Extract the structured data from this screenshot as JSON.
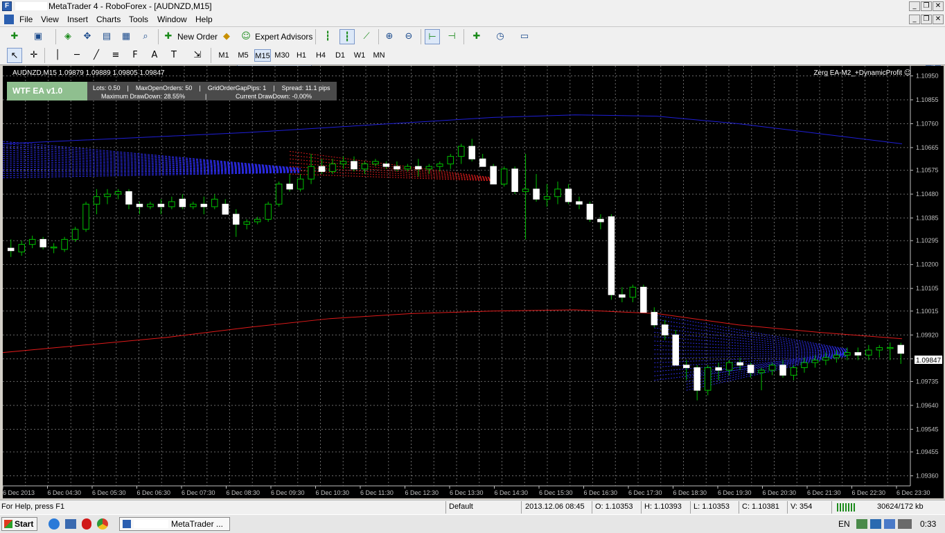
{
  "window": {
    "title": "MetaTrader 4 - RoboForex - [AUDNZD,M15]"
  },
  "menu": [
    "File",
    "View",
    "Insert",
    "Charts",
    "Tools",
    "Window",
    "Help"
  ],
  "toolbar": {
    "new_order": "New Order",
    "expert_advisors": "Expert Advisors"
  },
  "periods": [
    "M1",
    "M5",
    "M15",
    "M30",
    "H1",
    "H4",
    "D1",
    "W1",
    "MN"
  ],
  "active_period": "M15",
  "chart": {
    "symbol_header": "AUDNZD,M15  1.09879 1.09889 1.09805 1.09847",
    "ea_label": "Zerg EA-M2_+DynamicProfit",
    "infobox": {
      "title": "WTF EA v1.0",
      "line1": "Lots: 0.50    |    MaxOpenOrders: 50    |    GridOrderGapPips: 1    |    Spread: 11.1 pips",
      "line2a": "Maximum DrawDown: 28.55%",
      "line2b": "Current DrawDown: -0.00%"
    },
    "price_labels": [
      "1.10950",
      "1.10855",
      "1.10760",
      "1.10665",
      "1.10575",
      "1.10480",
      "1.10385",
      "1.10295",
      "1.10200",
      "1.10105",
      "1.10015",
      "1.09920",
      "1.09825",
      "1.09735",
      "1.09640",
      "1.09545",
      "1.09455",
      "1.09360"
    ],
    "current_price": "1.09847",
    "time_labels": [
      "6 Dec 2013",
      "6 Dec 04:30",
      "6 Dec 05:30",
      "6 Dec 06:30",
      "6 Dec 07:30",
      "6 Dec 08:30",
      "6 Dec 09:30",
      "6 Dec 10:30",
      "6 Dec 11:30",
      "6 Dec 12:30",
      "6 Dec 13:30",
      "6 Dec 14:30",
      "6 Dec 15:30",
      "6 Dec 16:30",
      "6 Dec 17:30",
      "6 Dec 18:30",
      "6 Dec 19:30",
      "6 Dec 20:30",
      "6 Dec 21:30",
      "6 Dec 22:30",
      "6 Dec 23:30"
    ],
    "colors": {
      "background": "#000000",
      "grid": "#6a6a6a",
      "bull": "#ffffff",
      "bear": "#ffffff",
      "wick": "#00c000",
      "ma_blue": "#1f1fd8",
      "ma_red": "#e01a1a"
    }
  },
  "chart_data": {
    "type": "candlestick",
    "ylim": [
      1.0932,
      1.1099
    ],
    "price_scale": [
      "1.10950",
      "1.10855",
      "1.10760",
      "1.10665",
      "1.10575",
      "1.10480",
      "1.10385",
      "1.10295",
      "1.10200",
      "1.10105",
      "1.10015",
      "1.09920",
      "1.09825",
      "1.09735",
      "1.09640",
      "1.09545",
      "1.09455",
      "1.09360"
    ],
    "time_scale": [
      "6 Dec 2013",
      "6 Dec 04:30",
      "6 Dec 05:30",
      "6 Dec 06:30",
      "6 Dec 07:30",
      "6 Dec 08:30",
      "6 Dec 09:30",
      "6 Dec 10:30",
      "6 Dec 11:30",
      "6 Dec 12:30",
      "6 Dec 13:30",
      "6 Dec 14:30",
      "6 Dec 15:30",
      "6 Dec 16:30",
      "6 Dec 17:30",
      "6 Dec 18:30",
      "6 Dec 19:30",
      "6 Dec 20:30",
      "6 Dec 21:30",
      "6 Dec 22:30",
      "6 Dec 23:30"
    ],
    "ohlc": [
      [
        1.10265,
        1.103,
        1.1023,
        1.10255
      ],
      [
        1.1025,
        1.10295,
        1.10235,
        1.1028
      ],
      [
        1.1028,
        1.10315,
        1.10265,
        1.103
      ],
      [
        1.103,
        1.1031,
        1.1026,
        1.1027
      ],
      [
        1.1027,
        1.10285,
        1.10245,
        1.1027
      ],
      [
        1.1026,
        1.1031,
        1.1025,
        1.103
      ],
      [
        1.103,
        1.1035,
        1.1029,
        1.1034
      ],
      [
        1.1034,
        1.1045,
        1.1033,
        1.1044
      ],
      [
        1.1044,
        1.105,
        1.104,
        1.1047
      ],
      [
        1.1047,
        1.105,
        1.1044,
        1.1048
      ],
      [
        1.1048,
        1.105,
        1.1046,
        1.1049
      ],
      [
        1.1049,
        1.105,
        1.1042,
        1.1044
      ],
      [
        1.1044,
        1.1045,
        1.104,
        1.1043
      ],
      [
        1.1043,
        1.1045,
        1.1042,
        1.1044
      ],
      [
        1.1044,
        1.1046,
        1.104,
        1.1043
      ],
      [
        1.1043,
        1.1047,
        1.1042,
        1.1045
      ],
      [
        1.1046,
        1.1048,
        1.1042,
        1.1043
      ],
      [
        1.1043,
        1.1045,
        1.1042,
        1.1044
      ],
      [
        1.1044,
        1.1047,
        1.104,
        1.1043
      ],
      [
        1.1043,
        1.1048,
        1.1042,
        1.1046
      ],
      [
        1.1044,
        1.1046,
        1.104,
        1.104
      ],
      [
        1.104,
        1.1042,
        1.1031,
        1.1036
      ],
      [
        1.1036,
        1.1038,
        1.1034,
        1.1037
      ],
      [
        1.1037,
        1.1039,
        1.1036,
        1.1038
      ],
      [
        1.1038,
        1.1045,
        1.1037,
        1.1044
      ],
      [
        1.1044,
        1.1053,
        1.1043,
        1.1052
      ],
      [
        1.1052,
        1.1056,
        1.1049,
        1.105
      ],
      [
        1.105,
        1.1056,
        1.1049,
        1.1054
      ],
      [
        1.1054,
        1.1064,
        1.1052,
        1.1059
      ],
      [
        1.1059,
        1.1062,
        1.1056,
        1.1057
      ],
      [
        1.1057,
        1.1062,
        1.1056,
        1.106
      ],
      [
        1.106,
        1.1063,
        1.1058,
        1.1061
      ],
      [
        1.1061,
        1.1063,
        1.1057,
        1.1058
      ],
      [
        1.1058,
        1.1061,
        1.1056,
        1.106
      ],
      [
        1.106,
        1.1062,
        1.1059,
        1.1061
      ],
      [
        1.106,
        1.1061,
        1.1058,
        1.1059
      ],
      [
        1.1059,
        1.1061,
        1.1057,
        1.1058
      ],
      [
        1.1058,
        1.106,
        1.1057,
        1.1059
      ],
      [
        1.1059,
        1.1062,
        1.1055,
        1.1058
      ],
      [
        1.1058,
        1.106,
        1.1056,
        1.1059
      ],
      [
        1.1059,
        1.1061,
        1.1057,
        1.106
      ],
      [
        1.106,
        1.1064,
        1.1058,
        1.1063
      ],
      [
        1.1063,
        1.1068,
        1.106,
        1.1067
      ],
      [
        1.1067,
        1.107,
        1.1061,
        1.1062
      ],
      [
        1.1062,
        1.1064,
        1.1059,
        1.1059
      ],
      [
        1.1059,
        1.106,
        1.1052,
        1.1052
      ],
      [
        1.1052,
        1.1059,
        1.1051,
        1.1058
      ],
      [
        1.1058,
        1.1059,
        1.1048,
        1.1049
      ],
      [
        1.1049,
        1.1064,
        1.103,
        1.105
      ],
      [
        1.105,
        1.1056,
        1.1045,
        1.1046
      ],
      [
        1.1046,
        1.1052,
        1.1043,
        1.1047
      ],
      [
        1.1047,
        1.1053,
        1.1044,
        1.105
      ],
      [
        1.105,
        1.1052,
        1.1044,
        1.1045
      ],
      [
        1.1045,
        1.1047,
        1.1042,
        1.1044
      ],
      [
        1.1044,
        1.1045,
        1.1037,
        1.1038
      ],
      [
        1.1038,
        1.104,
        1.1034,
        1.1037
      ],
      [
        1.1039,
        1.104,
        1.1006,
        1.1008
      ],
      [
        1.1008,
        1.1011,
        1.1005,
        1.1007
      ],
      [
        1.1007,
        1.1012,
        1.1005,
        1.1011
      ],
      [
        1.1011,
        1.1012,
        1.1001,
        1.1001
      ],
      [
        1.1001,
        1.1003,
        1.0995,
        1.0996
      ],
      [
        1.0996,
        1.0998,
        1.099,
        1.0992
      ],
      [
        1.0992,
        1.0994,
        1.098,
        1.098
      ],
      [
        1.098,
        1.0982,
        1.0974,
        1.0979
      ],
      [
        1.0979,
        1.098,
        1.0966,
        1.097
      ],
      [
        1.097,
        1.098,
        1.0968,
        1.0979
      ],
      [
        1.0979,
        1.0981,
        1.0974,
        1.0978
      ],
      [
        1.0978,
        1.0982,
        1.0976,
        1.0981
      ],
      [
        1.0981,
        1.0983,
        1.0978,
        1.098
      ],
      [
        1.098,
        1.0981,
        1.0975,
        1.0977
      ],
      [
        1.0977,
        1.0979,
        1.097,
        1.0978
      ],
      [
        1.0978,
        1.0981,
        1.0976,
        1.098
      ],
      [
        1.098,
        1.0982,
        1.0975,
        1.0976
      ],
      [
        1.0976,
        1.098,
        1.0974,
        1.0979
      ],
      [
        1.0979,
        1.0983,
        1.0977,
        1.0981
      ],
      [
        1.0981,
        1.0984,
        1.0979,
        1.0982
      ],
      [
        1.0982,
        1.0985,
        1.098,
        1.0983
      ],
      [
        1.0983,
        1.0986,
        1.0981,
        1.0984
      ],
      [
        1.0984,
        1.0987,
        1.0982,
        1.0985
      ],
      [
        1.0985,
        1.0987,
        1.0982,
        1.0984
      ],
      [
        1.0984,
        1.0988,
        1.0982,
        1.0986
      ],
      [
        1.0986,
        1.0988,
        1.0983,
        1.0987
      ],
      [
        1.0987,
        1.0989,
        1.0982,
        1.0987
      ],
      [
        1.09879,
        1.09889,
        1.09805,
        1.09847
      ]
    ],
    "ma_blue": [
      1.1068,
      1.10695,
      1.1071,
      1.10725,
      1.10745,
      1.10765,
      1.10785,
      1.10795,
      1.1079,
      1.1076,
      1.1072,
      1.1068
    ],
    "ma_red": [
      1.0985,
      1.0988,
      1.0991,
      1.0995,
      1.09985,
      1.10005,
      1.10015,
      1.1002,
      1.10005,
      1.0996,
      1.0993,
      1.09905
    ]
  },
  "status": {
    "help": "For Help, press F1",
    "profile": "Default",
    "datetime": "2013.12.06 08:45",
    "open": "O: 1.10353",
    "high": "H: 1.10393",
    "low": "L: 1.10353",
    "close": "C: 1.10381",
    "volume": "V: 354",
    "traffic": "30624/172 kb"
  },
  "taskbar": {
    "start": "Start",
    "task": "MetaTrader ...",
    "lang": "EN",
    "clock": "0:33"
  }
}
